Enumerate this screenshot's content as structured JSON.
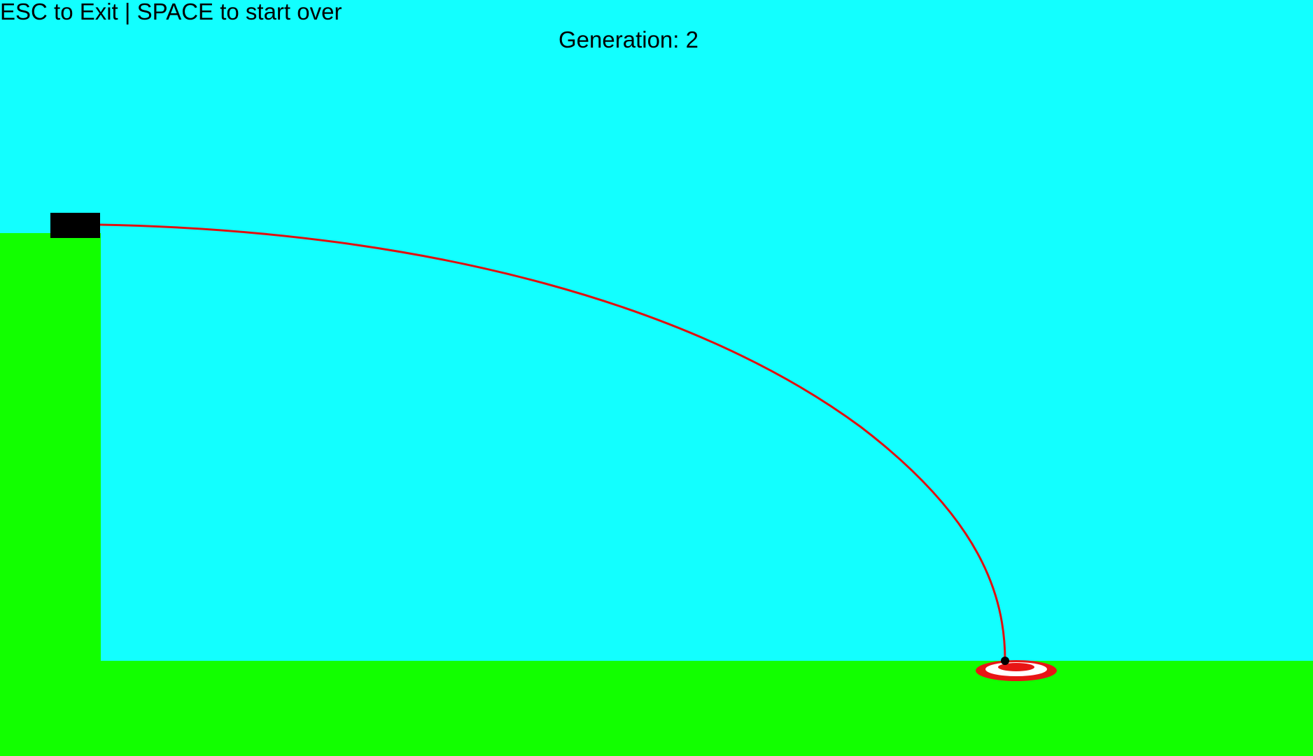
{
  "hud": {
    "controls_hint": "ESC to Exit | SPACE to start over",
    "generation_label": "Generation: 2"
  },
  "colors": {
    "sky": "#12ffff",
    "ground": "#12ff00",
    "trajectory": "#e01010",
    "cannon": "#000000",
    "target_red": "#e81515",
    "target_white": "#ffffff",
    "projectile": "#000000"
  },
  "icons": {
    "cannon": "cannon-block",
    "target": "bullseye-target",
    "projectile": "cannonball"
  }
}
